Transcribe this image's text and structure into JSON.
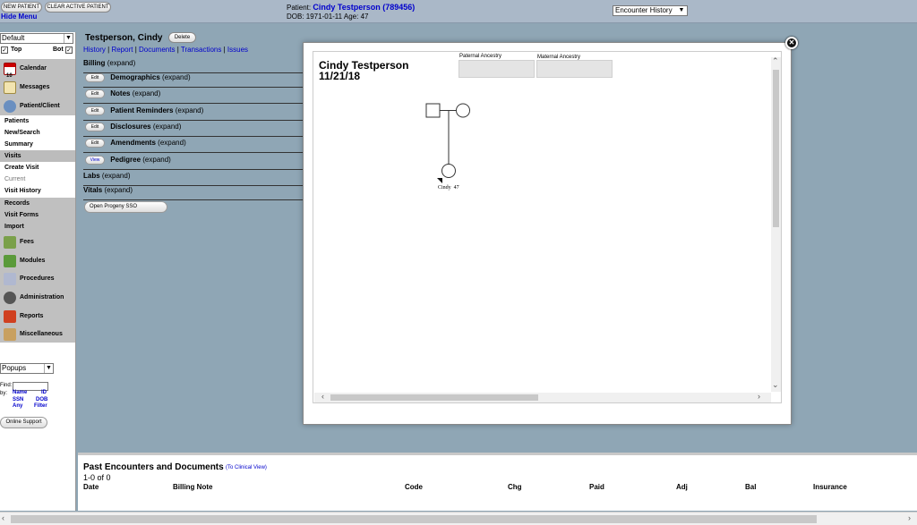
{
  "header": {
    "new_patient": "NEW PATIENT",
    "clear_active": "CLEAR ACTIVE PATIENT",
    "hide_menu": "Hide Menu",
    "patient_label": "Patient:",
    "patient_name": "Cindy Testperson (789456)",
    "dob_line": "DOB: 1971-01-11 Age: 47",
    "encounter_select": "Encounter History"
  },
  "leftnav": {
    "default_select": "Default",
    "top_label": "Top",
    "bot_label": "Bot",
    "icon_items": [
      {
        "label": "Calendar"
      },
      {
        "label": "Messages"
      },
      {
        "label": "Patient/Client"
      }
    ],
    "patients": "Patients",
    "new_search": "New/Search",
    "summary": "Summary",
    "visits": "Visits",
    "create_visit": "Create Visit",
    "current": "Current",
    "visit_history": "Visit History",
    "records": "Records",
    "visit_forms": "Visit Forms",
    "import": "Import",
    "icon_items2": [
      {
        "label": "Fees"
      },
      {
        "label": "Modules"
      },
      {
        "label": "Procedures"
      },
      {
        "label": "Administration"
      },
      {
        "label": "Reports"
      },
      {
        "label": "Miscellaneous"
      }
    ],
    "popups_select": "Popups",
    "find_label": "Find:",
    "by_label": "by:",
    "name_link": "Name",
    "id_link": "ID",
    "ssn_link": "SSN",
    "dob_link": "DOB",
    "any_link": "Any",
    "filter_link": "Filter",
    "online_support": "Online Support"
  },
  "summary": {
    "patient_name": "Testperson, Cindy",
    "delete": "Delete",
    "links": [
      "History",
      "Report",
      "Documents",
      "Transactions",
      "Issues"
    ],
    "sections": [
      {
        "btn": "",
        "title": "Billing",
        "expand": "(expand)"
      },
      {
        "btn": "Edit",
        "title": "Demographics",
        "expand": "(expand)"
      },
      {
        "btn": "Edit",
        "title": "Notes",
        "expand": "(expand)"
      },
      {
        "btn": "Edit",
        "title": "Patient Reminders",
        "expand": "(expand)"
      },
      {
        "btn": "Edit",
        "title": "Disclosures",
        "expand": "(expand)"
      },
      {
        "btn": "Edit",
        "title": "Amendments",
        "expand": "(expand)"
      },
      {
        "btn": "View",
        "title": "Pedigree",
        "expand": "(expand)"
      },
      {
        "btn": "",
        "title": "Labs",
        "expand": "(expand)"
      },
      {
        "btn": "",
        "title": "Vitals",
        "expand": "(expand)"
      }
    ],
    "open_progeny": "Open Progeny SSO"
  },
  "past": {
    "title": "Past Encounters and Documents",
    "clinical_link": "(To Clinical View)",
    "count": "1-0 of 0",
    "columns": [
      "Date",
      "Billing Note",
      "Code",
      "Chg",
      "Paid",
      "Adj",
      "Bal",
      "Insurance"
    ]
  },
  "pedigree": {
    "name": "Cindy Testperson",
    "date": "11/21/18",
    "paternal": "Paternal Ancestry",
    "maternal": "Maternal Ancestry",
    "child_label": "Cindy",
    "child_age": "47"
  },
  "colors": {
    "link": "#0000cc",
    "page_bg": "#8fa6b5",
    "header_bg": "#aab8c8"
  }
}
